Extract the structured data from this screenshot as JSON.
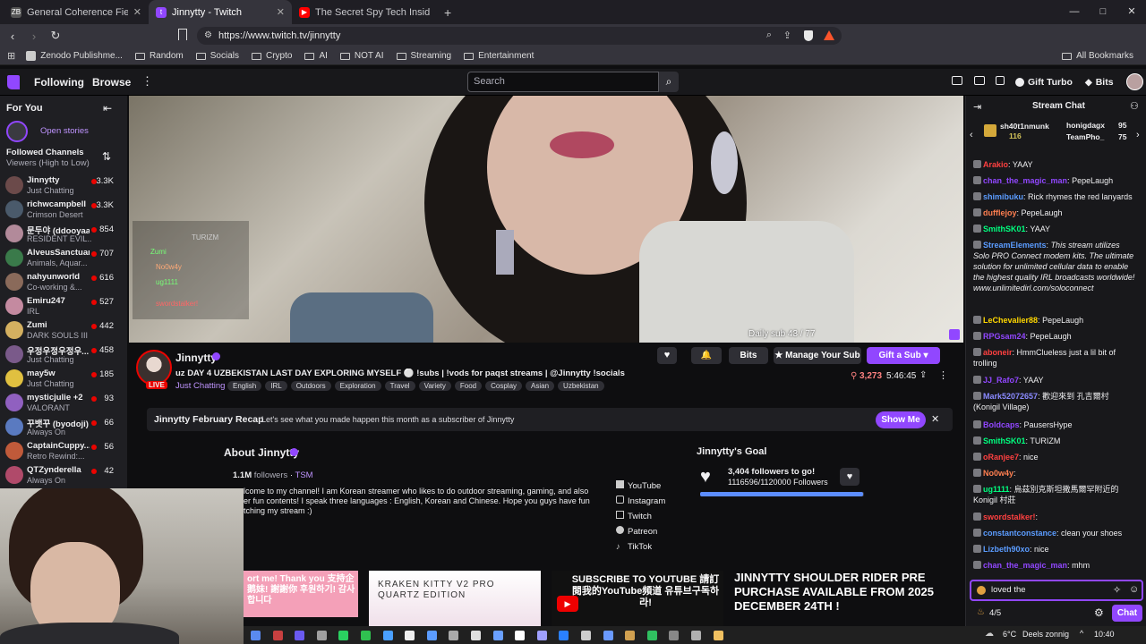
{
  "tabs": [
    {
      "label": "General Coherence Field Theory (GC",
      "icon": "paper-icon",
      "color": "#555"
    },
    {
      "label": "Jinnytty - Twitch",
      "icon": "twitch-icon",
      "color": "#9147ff"
    },
    {
      "label": "The Secret Spy Tech Inside Every Cre",
      "icon": "youtube-icon",
      "color": "#ff0000"
    }
  ],
  "window_controls": [
    "—",
    "□",
    "✕"
  ],
  "url": "https://www.twitch.tv/jinnytty",
  "bookmarks": [
    "Zenodo Publishme...",
    "Random",
    "Socials",
    "Crypto",
    "AI",
    "NOT AI",
    "Streaming",
    "Entertainment"
  ],
  "all_bookmarks": "All Bookmarks",
  "topnav": {
    "following": "Following",
    "browse": "Browse",
    "search_placeholder": "Search",
    "gift_turbo": "Gift Turbo",
    "bits": "Bits"
  },
  "sidebar": {
    "for_you": "For You",
    "open_stories": "Open stories",
    "followed_title": "Followed Channels",
    "followed_sort": "Viewers (High to Low)",
    "channels": [
      {
        "name": "Jinnytty",
        "game": "Just Chatting",
        "viewers": "3.3K",
        "color": "#6b4a4a"
      },
      {
        "name": "richwcampbell",
        "game": "Crimson Desert",
        "viewers": "3.3K",
        "color": "#4a5a6b"
      },
      {
        "name": "문두야 (ddooyaa)",
        "game": "RESIDENT EVIL...",
        "viewers": "854",
        "color": "#b28a9a"
      },
      {
        "name": "AlveusSanctuary",
        "game": "Animals, Aquar...",
        "viewers": "707",
        "color": "#3a7a4a"
      },
      {
        "name": "nahyunworld",
        "game": "Co-working &...",
        "viewers": "616",
        "color": "#8a6a5a"
      },
      {
        "name": "Emiru247",
        "game": "IRL",
        "viewers": "527",
        "color": "#c48aa0"
      },
      {
        "name": "Zumi",
        "game": "DARK SOULS III",
        "viewers": "442",
        "color": "#d4b060"
      },
      {
        "name": "우정우정우정우...",
        "game": "Just Chatting",
        "viewers": "458",
        "color": "#7a5a8a"
      },
      {
        "name": "may5w",
        "game": "Just Chatting",
        "viewers": "185",
        "color": "#e0c040"
      },
      {
        "name": "mysticjulie +2",
        "game": "VALORANT",
        "viewers": "93",
        "color": "#9060c0"
      },
      {
        "name": "꾸뱃꾸 (byodoji)",
        "game": "Always On",
        "viewers": "66",
        "color": "#5a7ac0"
      },
      {
        "name": "CaptainCuppy...",
        "game": "Retro Rewind:...",
        "viewers": "56",
        "color": "#c05a3a"
      },
      {
        "name": "QTZynderella",
        "game": "Always On",
        "viewers": "42",
        "color": "#b04a6a"
      }
    ]
  },
  "video": {
    "overlay_sub": "Daily sub 43 / 77",
    "overlay_names": [
      "TURIZM",
      "Zumi",
      "No0w4y",
      "ug1111",
      "swordstalker!"
    ]
  },
  "stream": {
    "name": "Jinnytty",
    "live": "LIVE",
    "title": "uz DAY 4 UZBEKISTAN LAST DAY EXPLORING MYSELF ⚪ !subs | !vods for paqst streams | @Jinnytty !socials",
    "category": "Just Chatting",
    "tags": [
      "English",
      "IRL",
      "Outdoors",
      "Exploration",
      "Travel",
      "Variety",
      "Food",
      "Cosplay",
      "Asian",
      "Uzbekistan"
    ],
    "viewers": "3,273",
    "uptime": "5:46:45",
    "bits": "Bits",
    "manage_sub": "Manage Your Sub",
    "gift_sub": "Gift a Sub"
  },
  "recap": {
    "title": "Jinnytty February Recap",
    "text": "Let's see what you made happen this month as a subscriber of Jinnytty",
    "button": "Show Me"
  },
  "about": {
    "title": "About Jinnytty",
    "followers": "1.1M",
    "followers_label": "followers",
    "team": "TSM",
    "bio": "lcome to my channel! I am Korean streamer who likes to do outdoor streaming, gaming, and also er fun contents! I speak three languages : English, Korean and Chinese. Hope you guys have fun tching my stream :)",
    "socials": [
      "YouTube",
      "Instagram",
      "Twitch",
      "Patreon",
      "TikTok"
    ]
  },
  "goal": {
    "title": "Jinnytty's Goal",
    "headline": "3,404 followers to go!",
    "detail": "1116596/1120000 Followers",
    "progress": 0.997
  },
  "panels": [
    {
      "text": "ort me! Thank you 支持企鹅妹! 謝謝你 후원하기! 감사합니다"
    },
    {
      "text": "KRAKEN KITTY V2 PRO QUARTZ EDITION"
    },
    {
      "text": "SUBSCRIBE TO YOUTUBE 請訂閱我的YouTube頻道 유튜브구독하라!"
    },
    {
      "text": "JINNYTTY SHOULDER RIDER PRE PURCHASE AVAILABLE FROM 2025 DECEMBER 24TH !"
    }
  ],
  "chat": {
    "title": "Stream Chat",
    "leaders": [
      {
        "name": "sh40t1nmunk",
        "count": "116"
      },
      {
        "name": "honigdagx",
        "count": "95"
      },
      {
        "name": "TeamPho_",
        "count": "75"
      }
    ],
    "messages": [
      {
        "user": "Arakio",
        "color": "#ff4040",
        "text": "YAAY"
      },
      {
        "user": "chan_the_magic_man",
        "color": "#9147ff",
        "text": "PepeLaugh"
      },
      {
        "user": "shimibuku",
        "color": "#5b9cff",
        "text": "Rick rhymes the red lanyards"
      },
      {
        "user": "dufflejoy",
        "color": "#ff7f50",
        "text": "PepeLaugh"
      },
      {
        "user": "SmithSK01",
        "color": "#00ff7f",
        "text": "YAAY"
      },
      {
        "user": "StreamElements",
        "color": "#5b9cff",
        "text": "This stream utilizes Solo PRO Connect modem kits. The ultimate solution for unlimited cellular data to enable the highest quality IRL broadcasts worldwide! www.unlimitedirl.com/soloconnect"
      },
      {
        "user": "LeChevalier88",
        "color": "#ffd700",
        "text": "PepeLaugh"
      },
      {
        "user": "RPGsam24",
        "color": "#9147ff",
        "text": "PepeLaugh"
      },
      {
        "user": "aboneir",
        "color": "#ff4040",
        "text": "HmmClueless just a lil bit of trolling"
      },
      {
        "user": "JJ_Rafo7",
        "color": "#9147ff",
        "text": "YAAY"
      },
      {
        "user": "Mark52072657",
        "color": "#8a8aff",
        "text": "歡迎來到 孔吉爾村 (Konigil Village)"
      },
      {
        "user": "Boldcaps",
        "color": "#9147ff",
        "text": "PausersHype"
      },
      {
        "user": "SmithSK01",
        "color": "#00ff7f",
        "text": "TURIZM"
      },
      {
        "user": "oRanjee7",
        "color": "#ff4040",
        "text": "nice"
      },
      {
        "user": "No0w4y",
        "color": "#ff7f50",
        "text": ""
      },
      {
        "user": "ug1111",
        "color": "#00ff7f",
        "text": "烏茲別克斯坦撒馬爾罕附近的 Konigil 村莊"
      },
      {
        "user": "swordstalker!",
        "color": "#ff4040",
        "text": ""
      },
      {
        "user": "constantconstance",
        "color": "#5b9cff",
        "text": "clean your shoes"
      },
      {
        "user": "Lizbeth90xo",
        "color": "#5b9cff",
        "text": "nice"
      },
      {
        "user": "chan_the_magic_man",
        "color": "#9147ff",
        "text": "mhm"
      }
    ],
    "input_value": "loved the",
    "points": "4/5",
    "send": "Chat"
  },
  "taskbar": {
    "weather": "6°C",
    "weather_text": "Deels zonnig",
    "time": "10:40"
  }
}
